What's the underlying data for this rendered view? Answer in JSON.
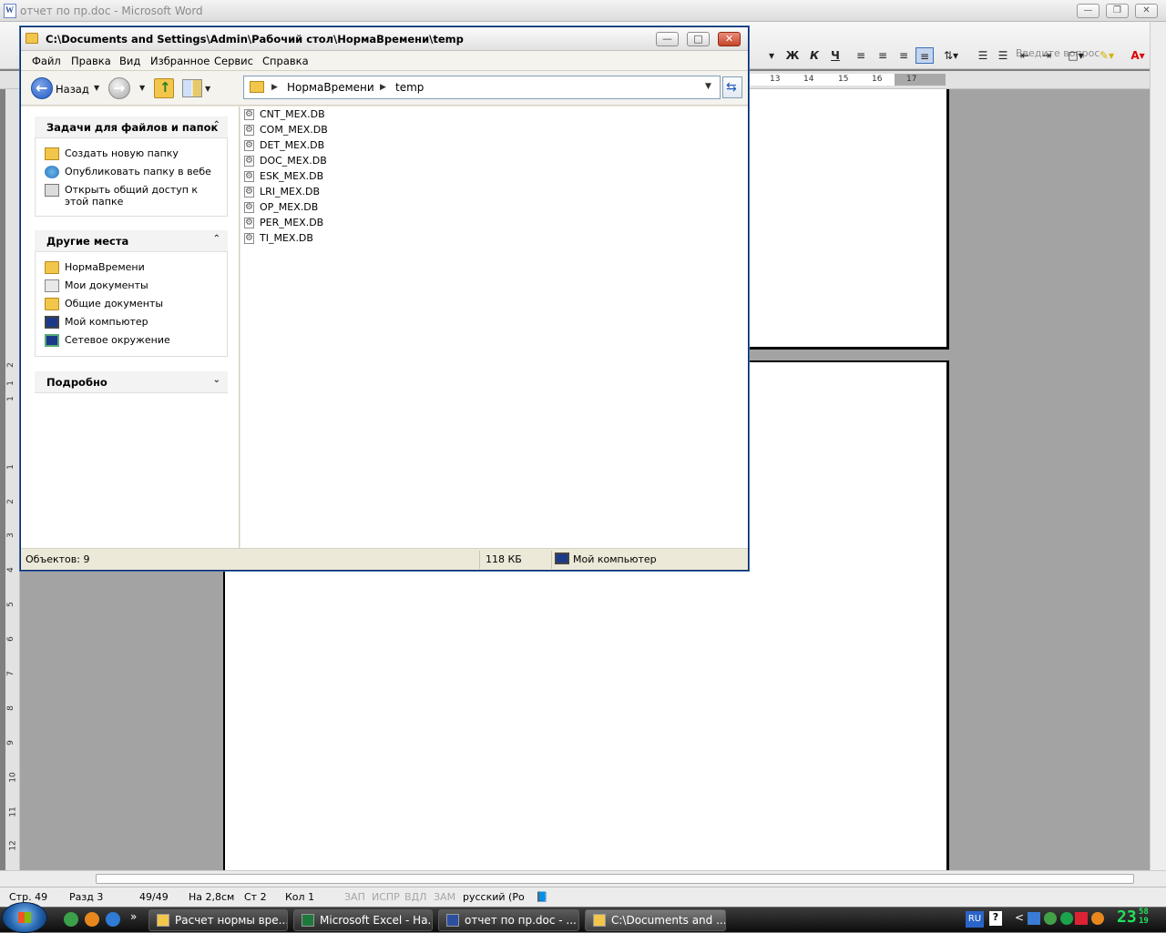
{
  "word": {
    "title": "отчет по пр.doc - Microsoft Word",
    "ask_placeholder": "Введите вопрос",
    "format_buttons": [
      "Ж",
      "К",
      "Ч"
    ],
    "ruler_marks": [
      "13",
      "14",
      "15",
      "16",
      "17"
    ],
    "vruler_marks": [
      "2",
      "1",
      "1",
      "1",
      "2",
      "3",
      "4",
      "5",
      "6",
      "7",
      "8",
      "9",
      "10",
      "11",
      "12"
    ],
    "status": {
      "page": "Стр. 49",
      "section": "Разд 3",
      "pages": "49/49",
      "at": "На 2,8см",
      "line": "Ст 2",
      "col": "Кол 1",
      "rec": "ЗАП",
      "trk": "ИСПР",
      "ext": "ВДЛ",
      "ovr": "ЗАМ",
      "lang": "русский (Ро"
    }
  },
  "explorer": {
    "title": "C:\\Documents and Settings\\Admin\\Рабочий стол\\НормаВремени\\temp",
    "menu": [
      "Файл",
      "Правка",
      "Вид",
      "Избранное",
      "Сервис",
      "Справка"
    ],
    "back_label": "Назад",
    "address": [
      "НормаВремени",
      "temp"
    ],
    "tasks_panel": {
      "title": "Задачи для файлов и папок",
      "items": [
        "Создать новую папку",
        "Опубликовать папку в вебе",
        "Открыть общий доступ к этой папке"
      ]
    },
    "places_panel": {
      "title": "Другие места",
      "items": [
        "НормаВремени",
        "Мои документы",
        "Общие документы",
        "Мой компьютер",
        "Сетевое окружение"
      ]
    },
    "details_panel": {
      "title": "Подробно"
    },
    "files": [
      "CNT_MEX.DB",
      "COM_MEX.DB",
      "DET_MEX.DB",
      "DOC_MEX.DB",
      "ESK_MEX.DB",
      "LRI_MEX.DB",
      "OP_MEX.DB",
      "PER_MEX.DB",
      "TI_MEX.DB"
    ],
    "status": {
      "objects": "Объектов: 9",
      "size": "118 КБ",
      "location": "Мой компьютер"
    }
  },
  "taskbar": {
    "tasks": [
      "Расчет нормы вре...",
      "Microsoft Excel - На...",
      "отчет по пр.doc - ...",
      "C:\\Documents and ..."
    ],
    "lang": "RU",
    "time": "23",
    "time_small_top": "58",
    "time_small_bottom": "19"
  }
}
